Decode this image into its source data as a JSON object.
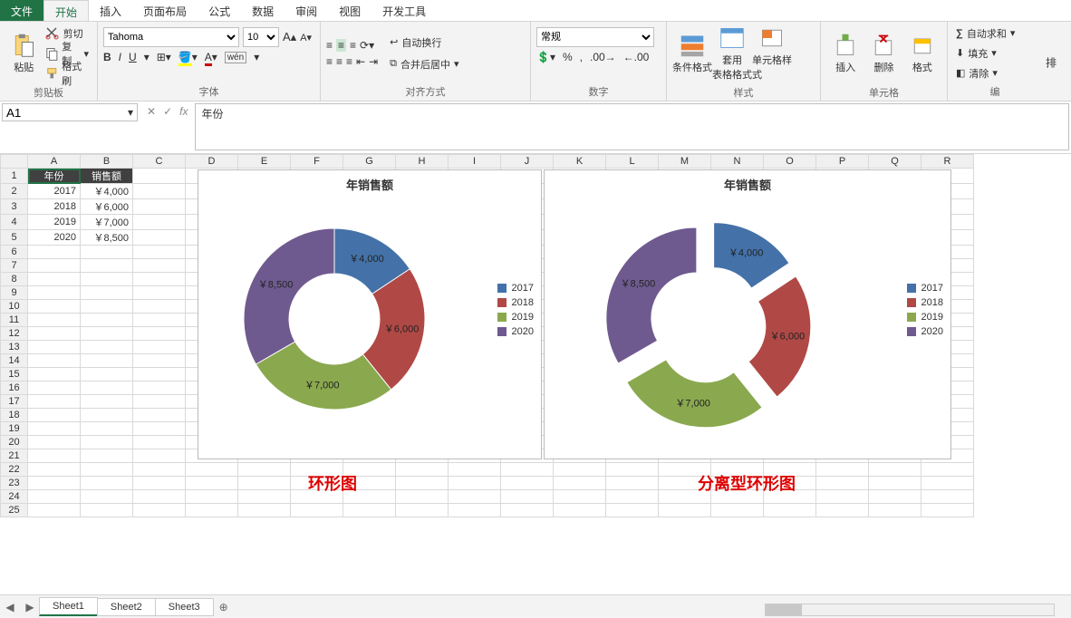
{
  "menu": {
    "file": "文件",
    "tabs": [
      "开始",
      "插入",
      "页面布局",
      "公式",
      "数据",
      "审阅",
      "视图",
      "开发工具"
    ],
    "active": 0
  },
  "ribbon": {
    "clipboard": {
      "paste": "粘贴",
      "cut": "剪切",
      "copy": "复制",
      "painter": "格式刷",
      "label": "剪贴板"
    },
    "font": {
      "name": "Tahoma",
      "size": "10",
      "label": "字体"
    },
    "align": {
      "wrap": "自动换行",
      "merge": "合并后居中",
      "label": "对齐方式"
    },
    "number": {
      "format": "常规",
      "label": "数字"
    },
    "styles": {
      "cond": "条件格式",
      "table": "套用\n表格格式",
      "cell": "单元格样式",
      "label": "样式"
    },
    "cells": {
      "insert": "插入",
      "delete": "删除",
      "format": "格式",
      "label": "单元格"
    },
    "editing": {
      "sum": "自动求和",
      "fill": "填充",
      "clear": "清除",
      "label": "编"
    }
  },
  "namebox": "A1",
  "formula": "年份",
  "columns": [
    "A",
    "B",
    "C",
    "D",
    "E",
    "F",
    "G",
    "H",
    "I",
    "J",
    "K",
    "L",
    "M",
    "N",
    "O",
    "P",
    "Q",
    "R"
  ],
  "rows": 25,
  "data": {
    "headers": [
      "年份",
      "销售额"
    ],
    "cells": [
      [
        "2017",
        "￥4,000"
      ],
      [
        "2018",
        "￥6,000"
      ],
      [
        "2019",
        "￥7,000"
      ],
      [
        "2020",
        "￥8,500"
      ]
    ]
  },
  "chart_data": [
    {
      "type": "doughnut",
      "title": "年销售额",
      "caption": "环形图",
      "exploded": false,
      "categories": [
        "2017",
        "2018",
        "2019",
        "2020"
      ],
      "values": [
        4000,
        6000,
        7000,
        8500
      ],
      "labels": [
        "￥4,000",
        "￥6,000",
        "￥7,000",
        "￥8,500"
      ],
      "colors": [
        "#4472a8",
        "#b04946",
        "#8aa94f",
        "#6f5a8f"
      ]
    },
    {
      "type": "doughnut",
      "title": "年销售额",
      "caption": "分离型环形图",
      "exploded": true,
      "categories": [
        "2017",
        "2018",
        "2019",
        "2020"
      ],
      "values": [
        4000,
        6000,
        7000,
        8500
      ],
      "labels": [
        "￥4,000",
        "￥6,000",
        "￥7,000",
        "￥8,500"
      ],
      "colors": [
        "#4472a8",
        "#b04946",
        "#8aa94f",
        "#6f5a8f"
      ]
    }
  ],
  "sheets": {
    "tabs": [
      "Sheet1",
      "Sheet2",
      "Sheet3"
    ],
    "active": 0
  }
}
